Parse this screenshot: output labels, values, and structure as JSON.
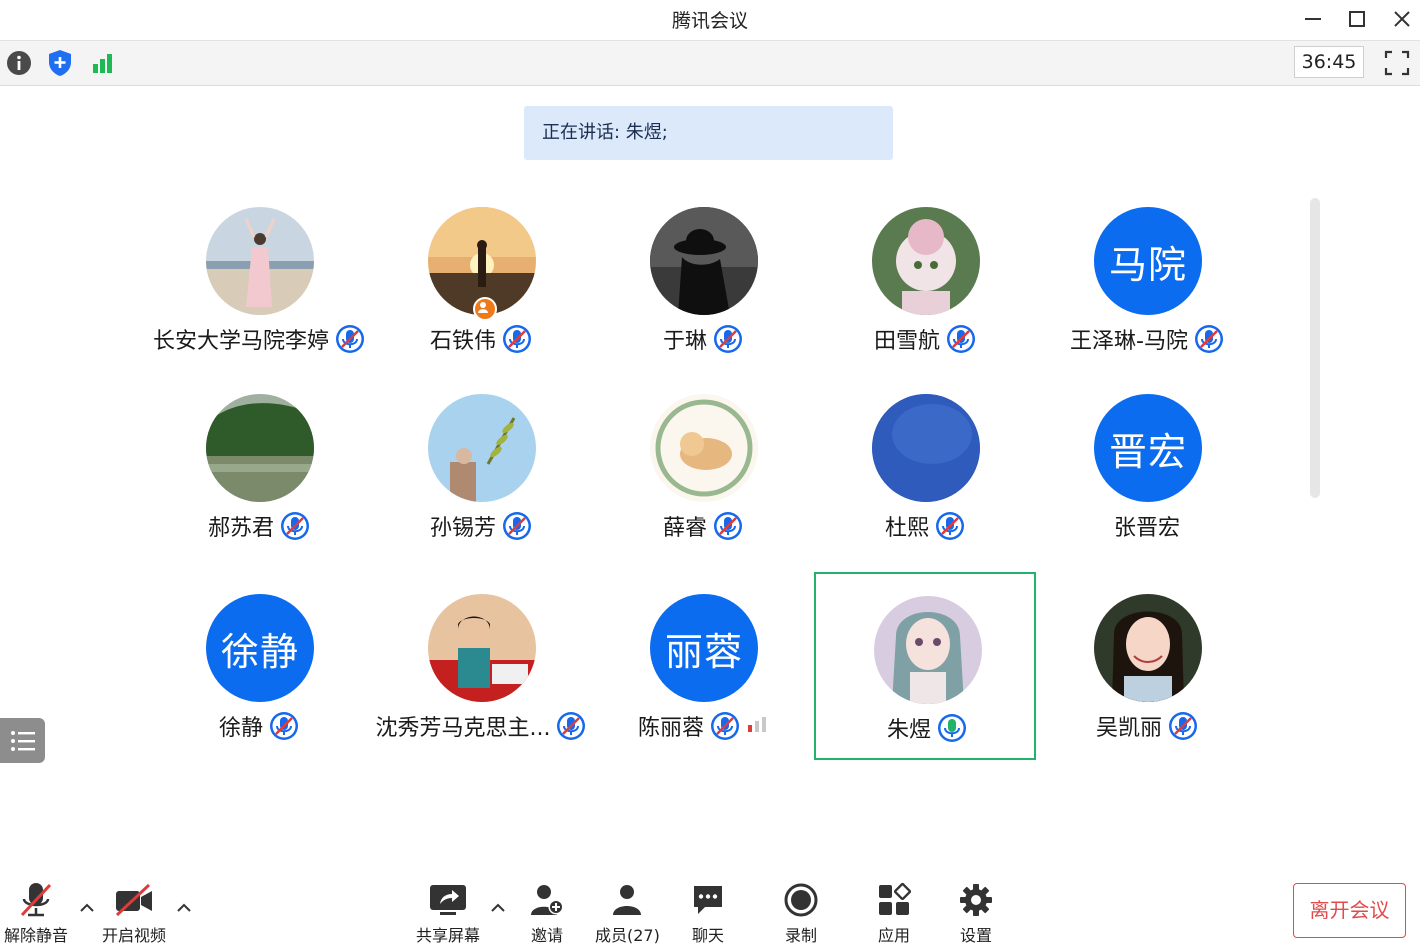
{
  "window": {
    "title": "腾讯会议"
  },
  "toolbar": {
    "timer": "36:45"
  },
  "speaking": {
    "text": "正在讲话: 朱煜;"
  },
  "participants": [
    {
      "name": "长安大学马院李婷",
      "mic": "muted"
    },
    {
      "name": "石铁伟",
      "mic": "muted",
      "host_badge": true
    },
    {
      "name": "于琳",
      "mic": "muted"
    },
    {
      "name": "田雪航",
      "mic": "muted"
    },
    {
      "name": "王泽琳-马院",
      "mic": "muted",
      "avatar_text": "马院"
    },
    {
      "name": "郝苏君",
      "mic": "muted"
    },
    {
      "name": "孙锡芳",
      "mic": "muted"
    },
    {
      "name": "薛睿",
      "mic": "muted"
    },
    {
      "name": "杜熙",
      "mic": "muted"
    },
    {
      "name": "张晋宏",
      "mic": "none",
      "avatar_text": "晋宏"
    },
    {
      "name": "徐静",
      "mic": "muted",
      "avatar_text": "徐静"
    },
    {
      "name": "沈秀芳马克思主...",
      "mic": "muted"
    },
    {
      "name": "陈丽蓉",
      "mic": "muted",
      "avatar_text": "丽蓉",
      "weak_signal": true
    },
    {
      "name": "朱煜",
      "mic": "speaking",
      "active": true
    },
    {
      "name": "吴凯丽",
      "mic": "muted"
    }
  ],
  "bottom_bar": {
    "unmute": "解除静音",
    "video": "开启视频",
    "share": "共享屏幕",
    "invite": "邀请",
    "members": "成员(27)",
    "chat": "聊天",
    "record": "录制",
    "apps": "应用",
    "settings": "设置",
    "leave": "离开会议"
  },
  "colors": {
    "accent": "#0b6cf0",
    "active_border": "#22b36a",
    "leave": "#e14b4b",
    "speaking_bg": "#dce9fb"
  }
}
